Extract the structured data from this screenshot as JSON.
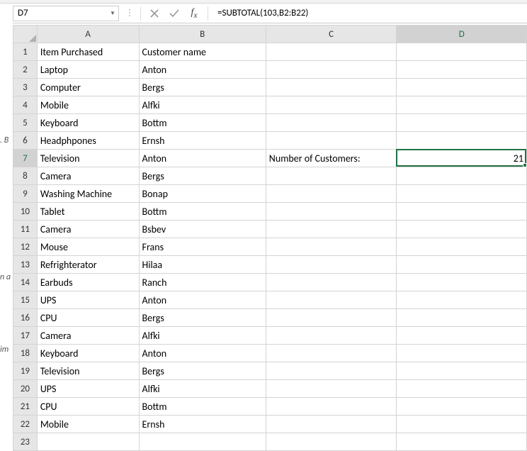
{
  "chart_data": {
    "type": "table",
    "title": "",
    "columns": [
      "Item Purchased",
      "Customer name"
    ],
    "rows": [
      [
        "Laptop",
        "Anton"
      ],
      [
        "Computer",
        "Bergs"
      ],
      [
        "Mobile",
        "Alfki"
      ],
      [
        "Keyboard",
        "Bottm"
      ],
      [
        "Headphpones",
        "Ernsh"
      ],
      [
        "Television",
        "Anton"
      ],
      [
        "Camera",
        "Bergs"
      ],
      [
        "Washing Machine",
        "Bonap"
      ],
      [
        "Tablet",
        "Bottm"
      ],
      [
        "Camera",
        "Bsbev"
      ],
      [
        "Mouse",
        "Frans"
      ],
      [
        "Refrighterator",
        "Hilaa"
      ],
      [
        "Earbuds",
        "Ranch"
      ],
      [
        "UPS",
        "Anton"
      ],
      [
        "CPU",
        "Bergs"
      ],
      [
        "Camera",
        "Alfki"
      ],
      [
        "Keyboard",
        "Anton"
      ],
      [
        "Television",
        "Bergs"
      ],
      [
        "UPS",
        "Alfki"
      ],
      [
        "CPU",
        "Bottm"
      ],
      [
        "Mobile",
        "Ernsh"
      ]
    ]
  },
  "formula_bar": {
    "cell_ref": "D7",
    "formula": "=SUBTOTAL(103,B2:B22)"
  },
  "columns": [
    "A",
    "B",
    "C",
    "D"
  ],
  "row_count": 23,
  "active_row": 7,
  "active_col": "D",
  "headers": {
    "A": "Item Purchased",
    "B": "Customer name"
  },
  "data": {
    "2": {
      "A": "Laptop",
      "B": "Anton"
    },
    "3": {
      "A": "Computer",
      "B": "Bergs"
    },
    "4": {
      "A": "Mobile",
      "B": "Alfki"
    },
    "5": {
      "A": "Keyboard",
      "B": "Bottm"
    },
    "6": {
      "A": "Headphpones",
      "B": "Ernsh"
    },
    "7": {
      "A": "Television",
      "B": "Anton",
      "C": "Number of Customers:",
      "D": "21"
    },
    "8": {
      "A": "Camera",
      "B": "Bergs"
    },
    "9": {
      "A": "Washing Machine",
      "B": "Bonap"
    },
    "10": {
      "A": "Tablet",
      "B": "Bottm"
    },
    "11": {
      "A": "Camera",
      "B": "Bsbev"
    },
    "12": {
      "A": "Mouse",
      "B": "Frans"
    },
    "13": {
      "A": "Refrighterator",
      "B": "Hilaa"
    },
    "14": {
      "A": "Earbuds",
      "B": "Ranch"
    },
    "15": {
      "A": "UPS",
      "B": "Anton"
    },
    "16": {
      "A": "CPU",
      "B": "Bergs"
    },
    "17": {
      "A": "Camera",
      "B": "Alfki"
    },
    "18": {
      "A": "Keyboard",
      "B": "Anton"
    },
    "19": {
      "A": "Television",
      "B": "Bergs"
    },
    "20": {
      "A": "UPS",
      "B": "Alfki"
    },
    "21": {
      "A": "CPU",
      "B": "Bottm"
    },
    "22": {
      "A": "Mobile",
      "B": "Ernsh"
    }
  },
  "gutter": {
    "g1": ". B",
    "g2": "n a",
    "g3": "im"
  }
}
